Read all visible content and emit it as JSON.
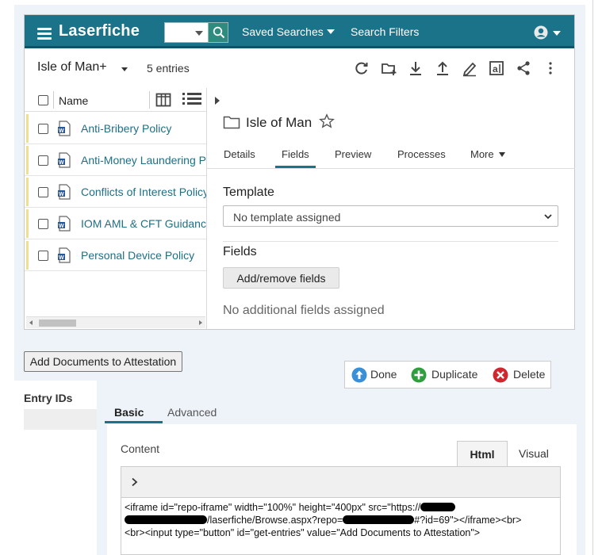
{
  "repo": {
    "brand": "Laserfiche",
    "nav": {
      "saved_searches": "Saved Searches",
      "search_filters": "Search Filters"
    },
    "folder_title": "Isle of Man+",
    "entry_count": "5 entries",
    "list": {
      "column_name": "Name",
      "items": [
        {
          "label": "Anti-Bribery Policy"
        },
        {
          "label": "Anti-Money Laundering Policy"
        },
        {
          "label": "Conflicts of Interest Policy"
        },
        {
          "label": "IOM AML & CFT Guidance"
        },
        {
          "label": "Personal Device Policy"
        }
      ]
    },
    "details": {
      "title": "Isle of Man",
      "tabs": [
        "Details",
        "Fields",
        "Preview",
        "Processes",
        "More"
      ],
      "active_tab": "Fields",
      "template_heading": "Template",
      "template_value": "No template assigned",
      "fields_heading": "Fields",
      "add_remove_label": "Add/remove fields",
      "no_fields_text": "No additional fields assigned"
    }
  },
  "form": {
    "attest_button": "Add Documents to Attestation",
    "actions": {
      "done": "Done",
      "duplicate": "Duplicate",
      "delete": "Delete"
    },
    "entry_ids_label": "Entry IDs",
    "tabs": {
      "basic": "Basic",
      "advanced": "Advanced"
    },
    "content_label": "Content",
    "editor_tabs": {
      "html": "Html",
      "visual": "Visual"
    },
    "code": {
      "line1": "<iframe id=\"repo-iframe\" width=\"100%\" height=\"400px\" src=\"https://",
      "line2a": "/laserfiche/Browse.aspx?repo=",
      "line2b": "#?id=69\"></iframe><br>",
      "line3": "<br><input type=\"button\" id=\"get-entries\" value=\"Add Documents to Attestation\">"
    }
  },
  "colors": {
    "header": "#1a7389",
    "link": "#1f6f84",
    "done": "#3a8fd6",
    "duplicate": "#2e9e3e",
    "delete": "#d0262f"
  }
}
